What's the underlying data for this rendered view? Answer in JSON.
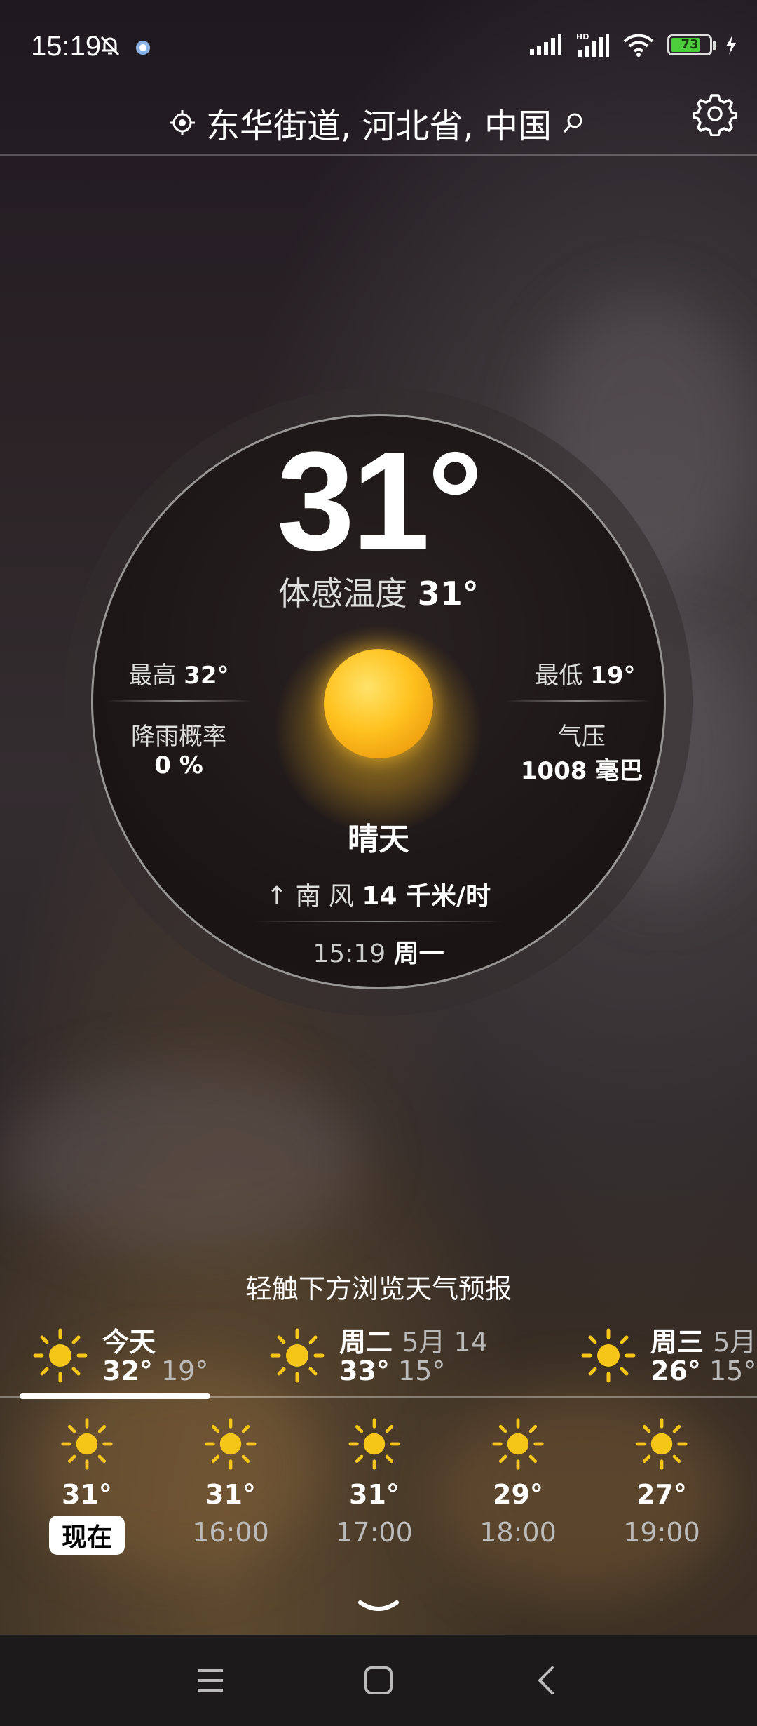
{
  "status_bar": {
    "time": "15:19",
    "battery": "73",
    "icons": [
      "bell-off-icon",
      "notification-app-icon",
      "signal-icon",
      "hd-signal-icon",
      "wifi-icon",
      "battery-icon",
      "charging-icon"
    ]
  },
  "header": {
    "location": "东华街道, 河北省, 中国",
    "icons": [
      "location-icon",
      "search-icon",
      "settings-icon"
    ]
  },
  "current": {
    "temperature": "31°",
    "feels_like_label": "体感温度",
    "feels_like_value": "31°",
    "high_label": "最高",
    "high_value": "32°",
    "low_label": "最低",
    "low_value": "19°",
    "rain_label": "降雨概率",
    "rain_value": "0 %",
    "pressure_label": "气压",
    "pressure_value": "1008 毫巴",
    "condition": "晴天",
    "wind_arrow": "↑",
    "wind_direction": "南 风",
    "wind_speed": "14 千米/时",
    "time": "15:19",
    "weekday": "周一"
  },
  "forecast_hint": "轻触下方浏览天气预报",
  "daily": [
    {
      "name": "今天",
      "date": "",
      "high": "32°",
      "low": "19°",
      "icon": "sun-icon"
    },
    {
      "name": "周二",
      "date": "5月 14",
      "high": "33°",
      "low": "15°",
      "icon": "sun-icon"
    },
    {
      "name": "周三",
      "date": "5月",
      "high": "26°",
      "low": "15°",
      "icon": "sun-icon"
    }
  ],
  "hourly": [
    {
      "temp": "31°",
      "time": "现在",
      "icon": "sun-icon"
    },
    {
      "temp": "31°",
      "time": "16:00",
      "icon": "sun-icon"
    },
    {
      "temp": "31°",
      "time": "17:00",
      "icon": "sun-icon"
    },
    {
      "temp": "29°",
      "time": "18:00",
      "icon": "sun-icon"
    },
    {
      "temp": "27°",
      "time": "19:00",
      "icon": "sun-icon"
    }
  ],
  "nav_bar": {
    "icons": [
      "menu-icon",
      "home-icon",
      "back-icon"
    ]
  },
  "colors": {
    "sun": "#f5c518",
    "battery": "#4ccd3c"
  }
}
